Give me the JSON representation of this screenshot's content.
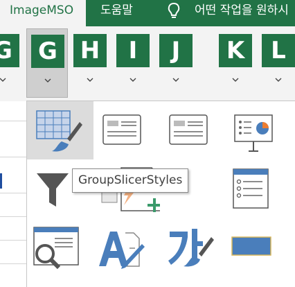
{
  "tabs": [
    {
      "label": "ImageMSO"
    },
    {
      "label": "도움말"
    },
    {
      "label": "어떤 작업을 원하시"
    }
  ],
  "ribbon": {
    "buttons": [
      {
        "label": "G"
      },
      {
        "label": "G"
      },
      {
        "label": "H"
      },
      {
        "label": "I"
      },
      {
        "label": "J"
      },
      {
        "label": "K"
      },
      {
        "label": "L"
      }
    ]
  },
  "tooltip": {
    "text": "GroupSlicerStyles"
  },
  "gallery": {
    "icons": [
      "table-style-brush-icon",
      "slide-layout-icon",
      "slide-layout-icon",
      "presentation-chart-icon",
      "filter-funnel-icon",
      "document-add-icon",
      "list-icon",
      "magnifier-window-icon",
      "text-font-edit-icon",
      "korean-char-brush-icon",
      "blue-rectangle-shape-icon"
    ]
  },
  "colors": {
    "accent": "#217346",
    "icon_blue": "#4a7ebb"
  }
}
